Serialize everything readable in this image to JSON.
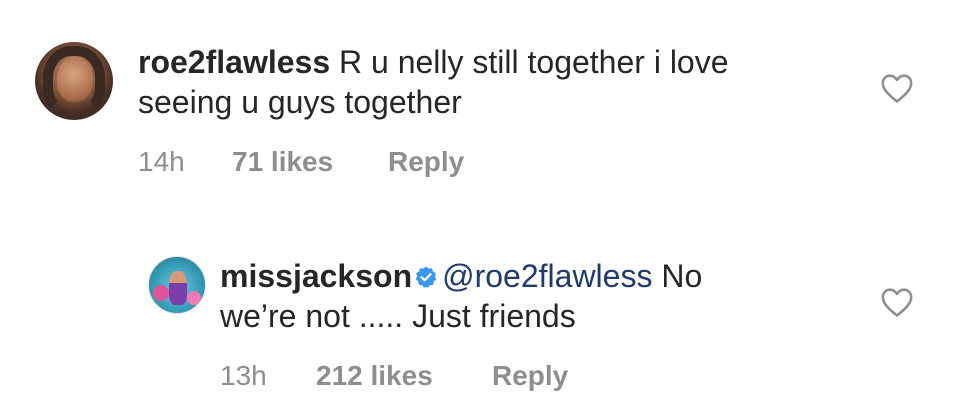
{
  "comments": [
    {
      "username": "roe2flawless",
      "text_line1": "R u nelly still together i love",
      "text_line2": "seeing u guys together",
      "time": "14h",
      "likes": "71 likes",
      "reply": "Reply",
      "avatar_icon": "profile-photo-roe2flawless",
      "like_icon": "heart-outline-icon"
    },
    {
      "username": "missjackson",
      "verified": true,
      "mention": "@roe2flawless",
      "text_line1_suffix": "No",
      "text_line2": "we’re not ..... Just friends",
      "time": "13h",
      "likes": "212 likes",
      "reply": "Reply",
      "avatar_icon": "profile-photo-missjackson",
      "like_icon": "heart-outline-icon"
    }
  ],
  "colors": {
    "text": "#262626",
    "meta": "#8e8e8e",
    "mention": "#1e3a6e",
    "verified": "#3897f0"
  }
}
